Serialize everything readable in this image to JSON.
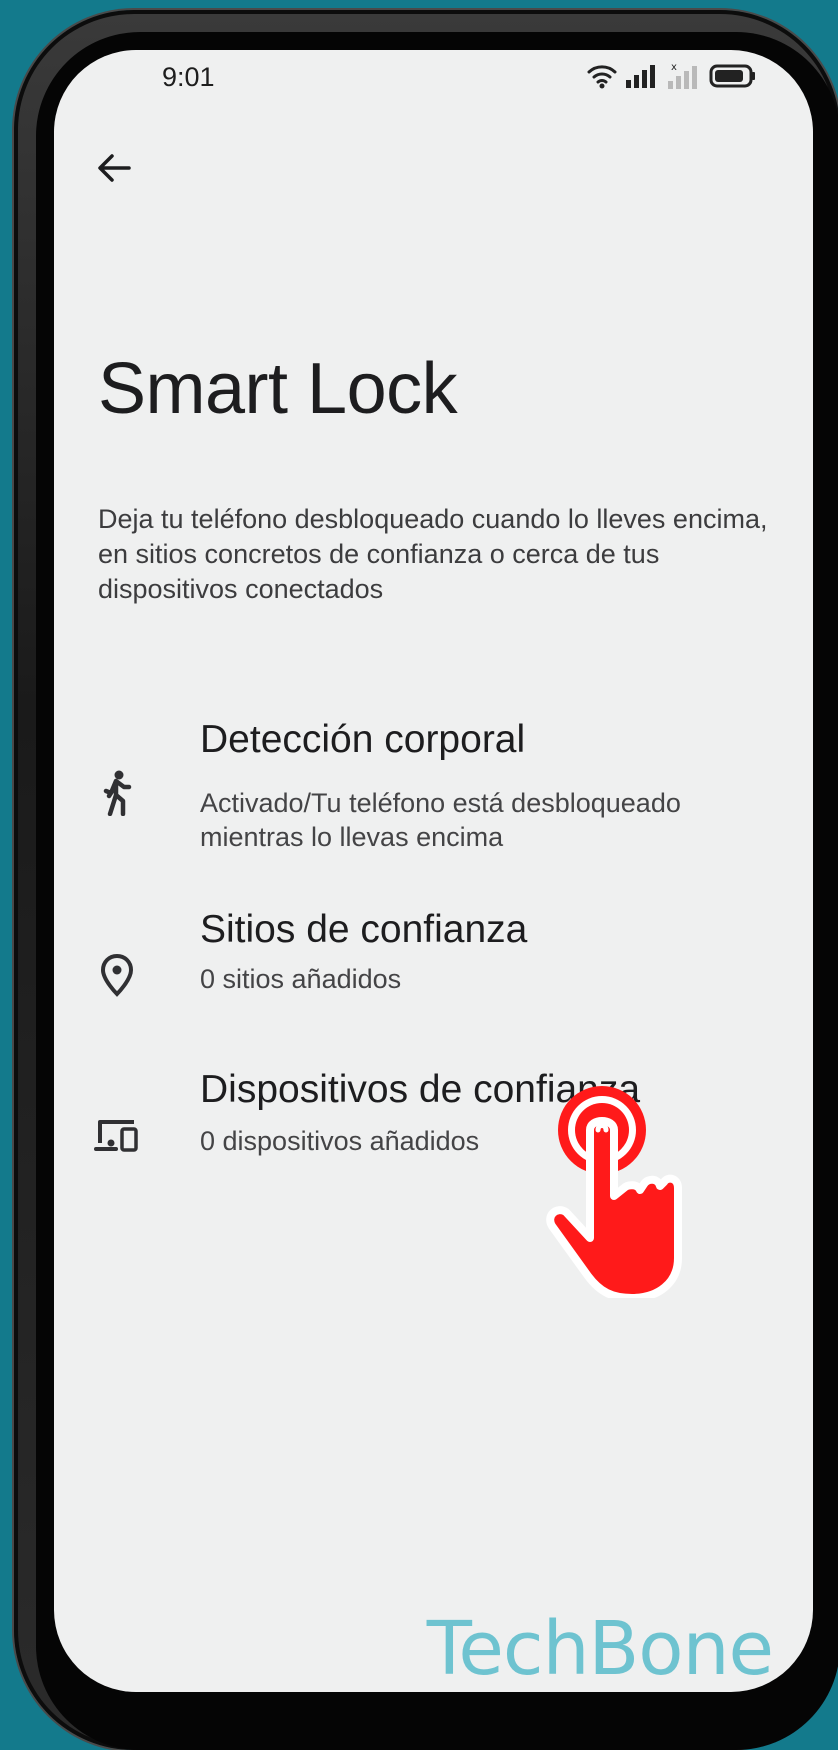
{
  "status_bar": {
    "time": "9:01",
    "icons": [
      "wifi-icon",
      "signal-icon",
      "signal-no-service-icon",
      "battery-icon"
    ]
  },
  "navigation": {
    "back_icon": "arrow-left-icon"
  },
  "page": {
    "title": "Smart Lock",
    "description": "Deja tu teléfono desbloqueado cuando lo lleves encima, en sitios concretos de confianza o cerca de tus dispositivos conectados"
  },
  "items": [
    {
      "icon": "walking-person-icon",
      "title": "Detección corporal",
      "subtitle": "Activado/Tu teléfono está desbloqueado mientras lo llevas encima"
    },
    {
      "icon": "location-pin-icon",
      "title": "Sitios de confianza",
      "subtitle": "0 sitios añadidos"
    },
    {
      "icon": "devices-icon",
      "title": "Dispositivos de confianza",
      "subtitle": "0 dispositivos añadidos"
    }
  ],
  "overlay": {
    "tap_icon": "tap-hand-icon",
    "tap_color": "#ff1a1a"
  },
  "watermark": "TechBone",
  "colors": {
    "background": "#137a8c",
    "screen": "#eff0f0",
    "watermark": "#6ec3d0"
  }
}
